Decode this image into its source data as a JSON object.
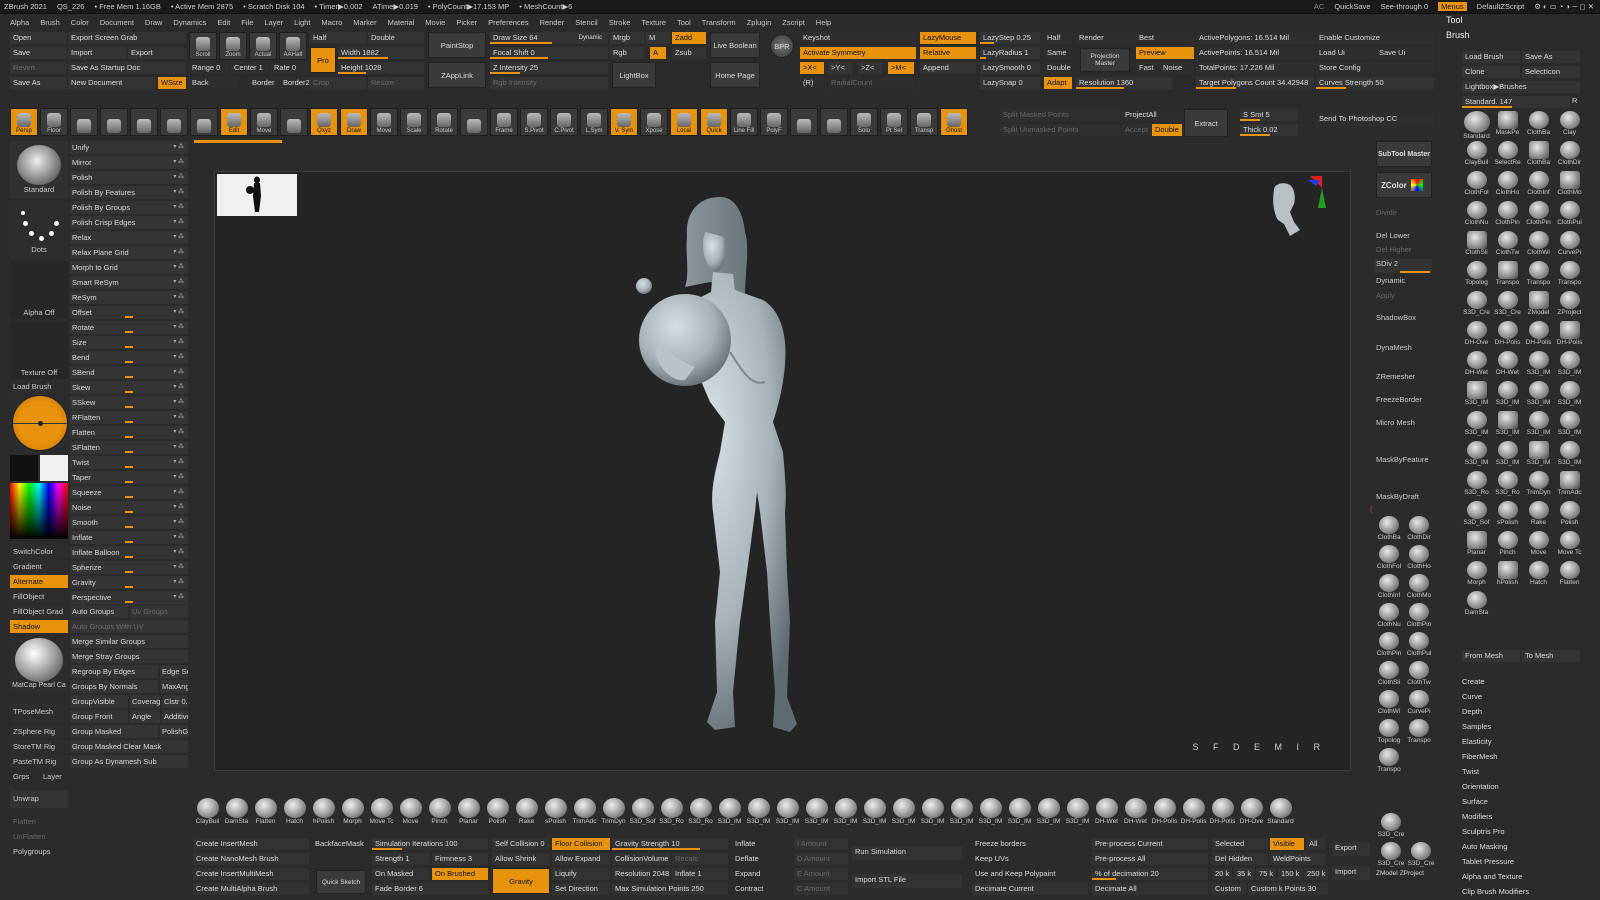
{
  "menubar": {
    "app": "ZBrush 2021",
    "project": "QS_226",
    "free_mem": "• Free Mem 1.16GB",
    "active_mem": "• Active Mem 2875",
    "scratch": "• Scratch Disk 104",
    "timer": "• Timer▶0.002",
    "atime": "ATime▶0.019",
    "polycount": "• PolyCount▶17.153 MP",
    "meshcount": "• MeshCount▶6",
    "ac": "AC",
    "quicksave": "QuickSave",
    "seethrough": "See-through  0",
    "menus": "Menus",
    "script": "DefaultZScript"
  },
  "menus": [
    "Alpha",
    "Brush",
    "Color",
    "Document",
    "Draw",
    "Dynamics",
    "Edit",
    "File",
    "Layer",
    "Light",
    "Macro",
    "Marker",
    "Material",
    "Movie",
    "Picker",
    "Preferences",
    "Render",
    "Stencil",
    "Stroke",
    "Texture",
    "Tool",
    "Transform",
    "Zplugin",
    "Zscript",
    "Help"
  ],
  "top": {
    "open": "Open",
    "save": "Save",
    "revert": "Revert",
    "saveas": "Save As",
    "export_grab": "Export Screen Grab",
    "import": "Import",
    "export": "Export",
    "save_startup": "Save As Startup Doc",
    "new_doc": "New Document",
    "wsize": "WSize",
    "scroll": "Scroll",
    "zoom": "Zoom",
    "actual": "Actual",
    "aahalf": "AAHalf",
    "range": "Range 0",
    "center": "Center 1",
    "rate": "Rate 0",
    "back": "Back",
    "border": "Border",
    "border2": "Border2",
    "crop": "Crop",
    "resize": "Resize",
    "half": "Half",
    "double": "Double",
    "pro": "Pro",
    "width": "Width 1882",
    "height": "Height 1028",
    "paintstop": "PaintStop",
    "zapplink": "ZAppLink",
    "drawsize": "Draw Size 64",
    "dynamic": "Dynamic",
    "focal": "Focal Shift 0",
    "zint": "Z Intensity 25",
    "rgbint": "Rgb Intensity",
    "mrgb": "Mrgb",
    "rgb": "Rgb",
    "m": "M",
    "a": "A",
    "zadd": "Zadd",
    "zsub": "Zsub",
    "liveboolean": "Live Boolean",
    "lightbox": "LightBox",
    "homepage": "Home Page",
    "bpr": "BPR",
    "keyshot": "Keyshot",
    "activate_sym": "Activate Symmetry",
    "x": ">X<",
    "y": ">Y<",
    "z": ">Z<",
    "mm": ">M<",
    "r": "(R)",
    "radialcount": "RadialCount",
    "lazymouse": "LazyMouse",
    "relative": "Relative",
    "append": "Append",
    "lazystep": "LazyStep 0.25",
    "lazyradius": "LazyRadius 1",
    "lazysmooth": "LazySmooth 0",
    "lazysnap": "LazySnap 0",
    "half2": "Half",
    "same": "Same",
    "double2": "Double",
    "adapt": "Adapt",
    "render": "Render",
    "projmaster": "Projection Master",
    "resolution": "Resolution 1360",
    "best": "Best",
    "preview": "Preview",
    "fast": "Fast",
    "noise": "Noise",
    "activepoly": "ActivePolygons: 16.514 Mil",
    "activepts": "ActivePoints: 16.514 Mil",
    "totalpts": "TotalPoints: 17.226 Mil",
    "target": "Target Polygons Count 34.42948",
    "enable_cust": "Enable Customize",
    "loadui": "Load Ui",
    "saveui": "Save Ui",
    "storeconfig": "Store Config",
    "curves": "Curves Strength 50"
  },
  "toolbar2": {
    "persp": "Persp",
    "floor": "Floor",
    "xyz": "Qxyz",
    "edit": "Edit",
    "draw": "Draw",
    "move": "Move",
    "scale": "Scale",
    "rotate": "Rotate",
    "move2": "Move",
    "zoom3d": "Zoom3D",
    "rotate2": "Rotate",
    "frame": "Frame",
    "spivot": "S.Pivot",
    "cpivot": "C.Pivot",
    "lsym": "L.Sym",
    "vsym": "V. Sym",
    "xpose": "Xpose",
    "local": "Local",
    "quick": "Quick",
    "linefill": "Line Fill",
    "polyf": "PolyF",
    "solo": "Solo",
    "ptsel": "Pt Sel",
    "transp": "Transp",
    "ghost": "Ghost",
    "split_masked": "Split Masked Points",
    "split_unmasked": "Split Unmasked Points",
    "projectall": "ProjectAll",
    "accept": "Accept",
    "double": "Double",
    "extract": "Extract",
    "ssmt": "S Smt 5",
    "thick": "Thick 0.02",
    "send_ps": "Send To Photoshop CC"
  },
  "left": {
    "standard": "Standard",
    "dots": "Dots",
    "alpha": "Alpha Off",
    "texture": "Texture Off",
    "loadbrush": "Load Brush",
    "switchcolor": "SwitchColor",
    "gradient": "Gradient",
    "alternate": "Alternate",
    "fillobject": "FillObject",
    "fillgrad": "FillObject Grad",
    "shadow": "Shadow",
    "matcap": "MatCap Pearl Ca",
    "tposemesh": "TPoseMesh",
    "zsphererig": "ZSphere Rig",
    "storetm": "StoreTM Rig",
    "pastetm": "PasteTM Rig",
    "grps": "Grps",
    "layer": "Layer",
    "unwrap": "Unwrap",
    "flatten": "Flatten",
    "unflatten": "UnFlatten",
    "polygroups": "Polygroups"
  },
  "deform": [
    "Unify",
    "Mirror",
    "Polish",
    "Polish By Features",
    "Polish By Groups",
    "Polish Crisp Edges",
    "Relax",
    "Relax Plane Grid",
    "Morph to Grid",
    "Smart ReSym",
    "ReSym",
    "Offset",
    "Rotate",
    "Size",
    "Bend",
    "SBend",
    "Skew",
    "SSkew",
    "RFlatten",
    "Flatten",
    "SFlatten",
    "Twist",
    "Taper",
    "Squeeze",
    "Noise",
    "Smooth",
    "Inflate",
    "Inflate Balloon",
    "Spherize",
    "Gravity",
    "Perspective"
  ],
  "groups": {
    "autogroups": "Auto Groups",
    "uvgroups": "Uv Groups",
    "autogroupsuv": "Auto Groups With UV",
    "merge_similar": "Merge Similar Groups",
    "merge_stray": "Merge Stray Groups",
    "regroup_edges": "Regroup By Edges",
    "edgese": "Edge Se",
    "by_normals": "Groups By Normals",
    "maxang": "MaxAng",
    "groupvisible": "GroupVisible",
    "coverage": "Coverage",
    "clstr": "Clstr 0.",
    "groupfront": "Group Front",
    "angle": "Angle",
    "additive": "Additive",
    "groupmasked": "Group Masked",
    "polishg": "PolishG",
    "gm_clear": "Group Masked Clear Mask",
    "as_dynamesh": "Group As Dynamesh Sub"
  },
  "viewport": {
    "signature": "S F D E M I R"
  },
  "rightmid": {
    "subtool": "SubTool Master",
    "zcolor": "ZColor",
    "divide": "Divide",
    "dellower": "Del Lower",
    "delhigher": "Del Higher",
    "sdiv": "SDiv 2",
    "dynamic": "Dynamic",
    "apply": "Apply",
    "shadowbox": "ShadowBox",
    "dynamesh": "DynaMesh",
    "zremesher": "ZRemesher",
    "freezeborder": "FreezeBorder",
    "micromesh": "Micro Mesh",
    "maskbyfeature": "MaskByFeature",
    "maskbydraft": "MaskByDraft"
  },
  "rightmid_brushes": [
    "ClothBa",
    "ClothDir",
    "ClothFol",
    "ClothHo",
    "ClothInf",
    "ClothMo",
    "ClothNu",
    "ClothPin",
    "ClothPin",
    "ClothPul",
    "ClothSli",
    "ClothTw",
    "ClothWi",
    "CurvePi",
    "Topolog",
    "Transpo",
    "Transpo"
  ],
  "tool": {
    "tool": "Tool",
    "brush": "Brush",
    "loadbrush": "Load Brush",
    "saveas": "Save As",
    "clone": "Clone",
    "selecticon": "SelectIcon",
    "lightbox": "Lightbox▶Brushes",
    "standard": "Standard. 147",
    "r": "R",
    "frommesh": "From Mesh",
    "tomesh": "To Mesh"
  },
  "brushes": [
    "Standard",
    "MaskPe",
    "ClothBa",
    "Clay",
    "ClayBuil",
    "SelectRe",
    "ClothBa",
    "ClothDir",
    "ClothFol",
    "ClothHo",
    "ClothInf",
    "ClothMo",
    "ClothNu",
    "ClothPin",
    "ClothPin",
    "ClothPul",
    "ClothSli",
    "ClothTw",
    "ClothWi",
    "CurvePi",
    "Topolog",
    "Transpo",
    "Transpo",
    "Transpo",
    "S3D_Cre",
    "S3D_Cre",
    "ZModel",
    "ZProject",
    "DH-Ove",
    "DH-Polis",
    "DH-Polis",
    "DH-Polis",
    "DH-Wet",
    "DH-Wet",
    "S3D_IM",
    "S3D_IM",
    "S3D_IM",
    "S3D_IM",
    "S3D_IM",
    "S3D_IM",
    "S3D_IM",
    "S3D_IM",
    "S3D_IM",
    "S3D_IM",
    "S3D_IM",
    "S3D_IM",
    "S3D_IM",
    "S3D_IM",
    "S3D_Ro",
    "S3D_Ro",
    "TrimDyn",
    "TrimAdc",
    "S3D_Sof",
    "sPolish",
    "Rake",
    "Polish",
    "Planar",
    "Pinch",
    "Move",
    "Move Tc",
    "Morph",
    "hPolish",
    "Hatch",
    "Flatten",
    "DamSta"
  ],
  "toolmenu": [
    "Create",
    "Curve",
    "Depth",
    "Samples",
    "Elasticity",
    "FiberMesh",
    "Twist",
    "Orientation",
    "Surface",
    "Modifiers",
    "Sculptris Pro",
    "Auto Masking",
    "Tablet Pressure",
    "Alpha and Texture",
    "Clip Brush Modifiers"
  ],
  "shelf": [
    "ClayBuil",
    "DamSta",
    "Flatten",
    "Hatch",
    "hPolish",
    "Morph",
    "Move Tc",
    "Move",
    "Pinch",
    "Planar",
    "Polish",
    "Rake",
    "sPolish",
    "TrimAdc",
    "TrimDyn",
    "S3D_Sof",
    "S3D_Ro",
    "S3D_Ro",
    "S3D_IM",
    "S3D_IM",
    "S3D_IM",
    "S3D_IM",
    "S3D_IM",
    "S3D_IM",
    "S3D_IM",
    "S3D_IM",
    "S3D_IM",
    "S3D_IM",
    "S3D_IM",
    "S3D_IM",
    "S3D_IM",
    "DH-Wet",
    "DH-Wet",
    "DH-Polis",
    "DH-Polis",
    "DH-Polis",
    "DH-Ove",
    "Standard"
  ],
  "bottom": {
    "insertmesh": "Create InsertMesh",
    "backface": "BackfaceMask",
    "nanomesh": "Create NanoMesh Brush",
    "insertmulti": "Create InsertMultiMesh",
    "multialpha": "Create MultiAlpha Brush",
    "quicksketch": "Quick Sketch",
    "siminter": "Simulation Iterations 100",
    "strength": "Strength 1",
    "firmness": "Firmness 3",
    "onmasked": "On Masked",
    "onbrushed": "On Brushed",
    "fadeborder": "Fade Border 6",
    "selfcoll": "Self Collision 0",
    "floorcoll": "Floor Collision",
    "allowshrink": "Allow Shrink",
    "allowexpand": "Allow Expand",
    "gravity": "Gravity",
    "liquify": "Liquify",
    "setdir": "Set Direction",
    "gravstr": "Gravity Strength 10",
    "collvol": "CollisionVolume",
    "recalc": "Recalc",
    "resolution": "Resolution 2048",
    "inflate1": "Inflate 1",
    "maxsim": "Max Simulation Points 250",
    "inflate": "Inflate",
    "deflate": "Deflate",
    "expand": "Expand",
    "contract": "Contract",
    "iamount": "I Amount",
    "damount": "D Amount",
    "eamount": "E Amount",
    "camount": "C Amount",
    "runsim": "Run Simulation",
    "importstl": "Import STL File",
    "freeze": "Freeze borders",
    "keepuvs": "Keep UVs",
    "usekeep": "Use and Keep Polypaint",
    "decimatecur": "Decimate Current",
    "preprocess": "Pre-process Current",
    "preprocessall": "Pre-process All",
    "pctdec": "% of decimation 20",
    "decimateall": "Decimate All",
    "selected": "Selected",
    "visible": "Visible",
    "all": "All",
    "delhidden": "Del Hidden",
    "weldpoints": "WeldPoints",
    "k20": "20 k",
    "k35": "35 k",
    "k75": "75 k",
    "k150": "150 k",
    "k250": "250 k",
    "custom": "Custom",
    "customk": "Custom k Points 30",
    "export": "Export",
    "import": "Import",
    "s3dcre": "S3D_Cre",
    "s3dcre2": "S3D_Cre",
    "s3dcre3": "S3D_Cre",
    "zmodel": "ZModel",
    "zproject": "ZProject"
  },
  "colors": {
    "accent": "#e8930c",
    "panel": "#333333",
    "viewport": "#242424"
  }
}
